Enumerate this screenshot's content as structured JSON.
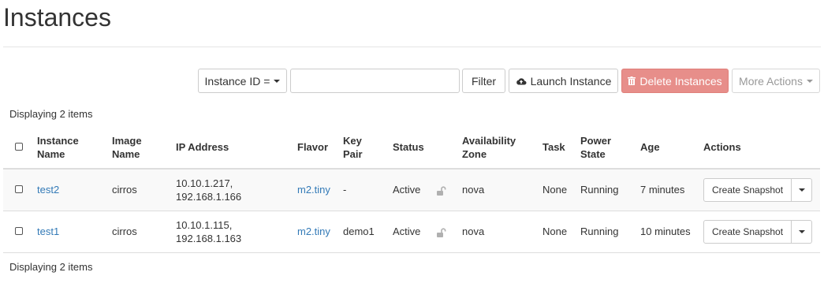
{
  "page": {
    "title": "Instances"
  },
  "toolbar": {
    "filter_field_label": "Instance ID =",
    "search_value": "",
    "filter_label": "Filter",
    "launch_label": "Launch Instance",
    "delete_label": "Delete Instances",
    "more_label": "More Actions"
  },
  "info": {
    "top": "Displaying 2 items",
    "bottom": "Displaying 2 items"
  },
  "table": {
    "headers": {
      "name_line1": "Instance",
      "name_line2": "Name",
      "image_line1": "Image",
      "image_line2": "Name",
      "ip": "IP Address",
      "flavor": "Flavor",
      "keypair_line1": "Key",
      "keypair_line2": "Pair",
      "status": "Status",
      "az_line1": "Availability",
      "az_line2": "Zone",
      "task": "Task",
      "power_line1": "Power",
      "power_line2": "State",
      "age": "Age",
      "actions": "Actions"
    },
    "rows": [
      {
        "name": "test2",
        "image": "cirros",
        "ip1": "10.10.1.217,",
        "ip2": "192.168.1.166",
        "flavor": "m2.tiny",
        "keypair": "-",
        "status": "Active",
        "az": "nova",
        "task": "None",
        "power": "Running",
        "age": "7 minutes",
        "action": "Create Snapshot"
      },
      {
        "name": "test1",
        "image": "cirros",
        "ip1": "10.10.1.115,",
        "ip2": "192.168.1.163",
        "flavor": "m2.tiny",
        "keypair": "demo1",
        "status": "Active",
        "az": "nova",
        "task": "None",
        "power": "Running",
        "age": "10 minutes",
        "action": "Create Snapshot"
      }
    ]
  },
  "colors": {
    "link": "#337ab7",
    "danger_disabled": "#e78e8a",
    "border": "#dddddd"
  },
  "icons": {
    "launch": "cloud-upload-icon",
    "delete": "trash-icon",
    "lock": "unlock-icon",
    "caret": "caret-down-icon"
  }
}
